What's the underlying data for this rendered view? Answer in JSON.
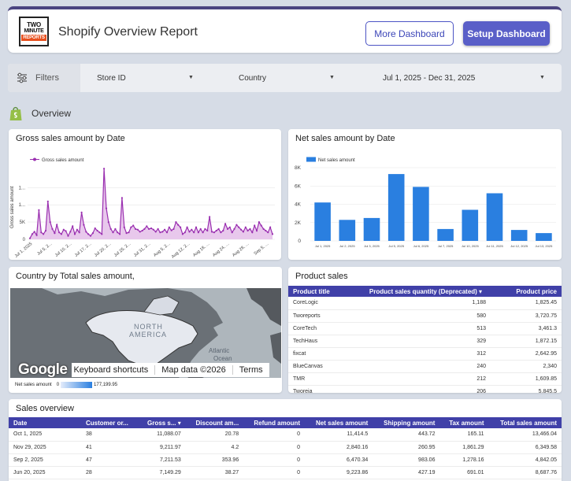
{
  "header": {
    "logo": {
      "line1": "TWO",
      "line2": "MINUTE",
      "line3": "REPORTS"
    },
    "title": "Shopify Overview Report",
    "more_button": "More Dashboard",
    "setup_button": "Setup Dashboard"
  },
  "filters": {
    "label": "Filters",
    "store": "Store ID",
    "country": "Country",
    "date_range": "Jul 1, 2025 - Dec 31, 2025"
  },
  "overview": {
    "label": "Overview"
  },
  "gross_chart": {
    "title": "Gross sales amount by Date",
    "legend": "Gross sales amount",
    "ylabel": "Gross sales amount",
    "yticks": [
      "0",
      "5K",
      "1...",
      "1..."
    ],
    "xticks": [
      "Jul 1, 2025",
      "Jul 5, 2...",
      "Jul 10, 2...",
      "Jul 17, 2...",
      "Jul 20, 2...",
      "Jul 25, 2...",
      "Jul 31, 2...",
      "Aug 5, 2...",
      "Aug 12, 2...",
      "Aug 18, ...",
      "Aug 24, ...",
      "Aug 28, ...",
      "Sep 5, ..."
    ]
  },
  "net_chart": {
    "title": "Net sales amount by Date",
    "legend": "Net sales amount",
    "yticks": [
      "0",
      "2K",
      "4K",
      "6K",
      "8K"
    ]
  },
  "map": {
    "title": "Country by Total sales amount,",
    "label_north": "NORTH",
    "label_america": "AMERICA",
    "label_atlantic": "Atlantic",
    "label_ocean": "Ocean",
    "google": "Google",
    "shortcuts": "Keyboard shortcuts",
    "mapdata": "Map data ©2026",
    "terms": "Terms",
    "legend_label": "Net sales amount",
    "legend_min": "0",
    "legend_max": "177,199.95"
  },
  "product_sales": {
    "title": "Product sales",
    "columns": [
      "Product title",
      "Product sales quantity (Deprecated) ▾",
      "Product price"
    ],
    "rows": [
      [
        "CoreLogic",
        "1,188",
        "1,825.45"
      ],
      [
        "Tworeports",
        "580",
        "3,720.75"
      ],
      [
        "CoreTech",
        "513",
        "3,461.3"
      ],
      [
        "TechHaus",
        "329",
        "1,872.15"
      ],
      [
        "fixcat",
        "312",
        "2,642.95"
      ],
      [
        "BlueCanvas",
        "240",
        "2,340"
      ],
      [
        "TMR",
        "212",
        "1,609.85"
      ],
      [
        "Tworeia",
        "206",
        "5,845.5"
      ]
    ]
  },
  "sales_overview": {
    "title": "Sales overview",
    "columns": [
      "Date",
      "Customer or...",
      "Gross s... ▾",
      "Discount am...",
      "Refund amount",
      "Net sales amount",
      "Shipping amount",
      "Tax amount",
      "Total sales amount"
    ],
    "rows": [
      [
        "Oct 1, 2025",
        "38",
        "11,088.07",
        "20.78",
        "0",
        "11,414.5",
        "443.72",
        "165.11",
        "13,466.04"
      ],
      [
        "Nov 29, 2025",
        "41",
        "9,211.97",
        "4.2",
        "0",
        "2,840.16",
        "260.95",
        "1,861.29",
        "6,349.58"
      ],
      [
        "Sep 2, 2025",
        "47",
        "7,211.53",
        "353.96",
        "0",
        "6,470.34",
        "983.06",
        "1,278.16",
        "4,842.05"
      ],
      [
        "Jun 20, 2025",
        "28",
        "7,149.29",
        "38.27",
        "0",
        "9,223.86",
        "427.19",
        "691.01",
        "8,687.76"
      ]
    ]
  },
  "chart_data": [
    {
      "type": "line",
      "title": "Gross sales amount by Date",
      "ylabel": "Gross sales amount",
      "series": [
        {
          "name": "Gross sales amount",
          "values": [
            300,
            1500,
            2200,
            1200,
            8500,
            2000,
            1500,
            2500,
            11000,
            5000,
            3000,
            1800,
            4200,
            2000,
            1500,
            2800,
            2400,
            1000,
            2200,
            3800,
            1500,
            2800,
            2000,
            7800,
            4200,
            2200,
            1500,
            1000,
            1800,
            3200,
            2500,
            2000,
            1500,
            20500,
            9000,
            5000,
            3000,
            2000,
            3000,
            2000,
            1500,
            12000,
            3500,
            1800,
            2000,
            3500,
            4000,
            3000,
            2800,
            2200,
            2500,
            3000,
            3800,
            3000,
            3200,
            2800,
            2200,
            3000,
            2000,
            2200,
            2800,
            2000,
            3500,
            2600,
            3000,
            5000,
            4200,
            3500,
            1500,
            2000,
            3500,
            2200,
            2800,
            2000,
            3500,
            2000,
            3000,
            2000,
            3000,
            2500,
            6500,
            2200,
            2000,
            2500,
            3000,
            2000,
            2500,
            4500,
            3000,
            3500,
            2000,
            3000,
            4200,
            3500,
            2800,
            2200,
            3500,
            2500,
            3000,
            2000,
            4000,
            2500,
            5000,
            4000,
            3000,
            2500,
            2000,
            3500,
            1500
          ]
        }
      ]
    },
    {
      "type": "bar",
      "title": "Net sales amount by Date",
      "categories": [
        "Jul 1, 2025",
        "Jul 2, 2025",
        "Jul 3, 2025",
        "Jul 5, 2025",
        "Jul 6, 2025",
        "Jul 7, 2025",
        "Jul 10, 2025",
        "Jul 11, 2025",
        "Jul 12, 2025",
        "Jul 13, 2025"
      ],
      "series": [
        {
          "name": "Net sales amount",
          "values": [
            4200,
            2300,
            2500,
            7300,
            5900,
            1300,
            3400,
            5200,
            1200,
            850
          ]
        }
      ],
      "ylim": [
        0,
        8000
      ]
    }
  ],
  "colors": {
    "accent": "#4040a8",
    "line": "#9a2fb0",
    "bar": "#2a7fe0",
    "setup": "#5a5fc8"
  }
}
